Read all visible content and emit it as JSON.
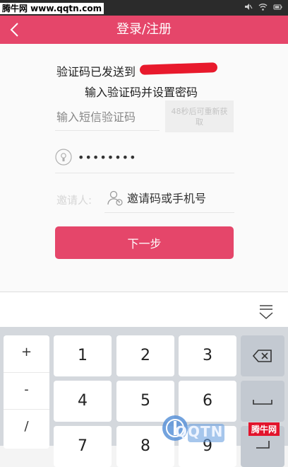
{
  "watermark": {
    "top_text": "腾牛网 www.qqtn.com",
    "badge_text": "QQTN",
    "corner_text": "腾牛网"
  },
  "status_bar": {
    "icons": [
      "silent-icon",
      "wifi-icon",
      "battery-icon"
    ]
  },
  "header": {
    "title": "登录/注册",
    "back_icon": "chevron-left-icon"
  },
  "form": {
    "sent_text": "验证码已发送到",
    "instruction": "输入验证码并设置密码",
    "code_placeholder": "输入短信验证码",
    "resend_label": "48秒后可重新获取",
    "password_value": "••••••••",
    "inviter_label": "邀请人:",
    "inviter_placeholder": "邀请码或手机号",
    "next_label": "下一步"
  },
  "keyboard": {
    "symbols": [
      "+",
      "-",
      "/"
    ],
    "digits": [
      "1",
      "2",
      "3",
      "4",
      "5",
      "6",
      "7",
      "8",
      "9"
    ],
    "function_keys": [
      "backspace-icon",
      "space-icon",
      "enter-icon"
    ]
  },
  "colors": {
    "brand": "#e5466a",
    "redaction": "#e8192c"
  }
}
